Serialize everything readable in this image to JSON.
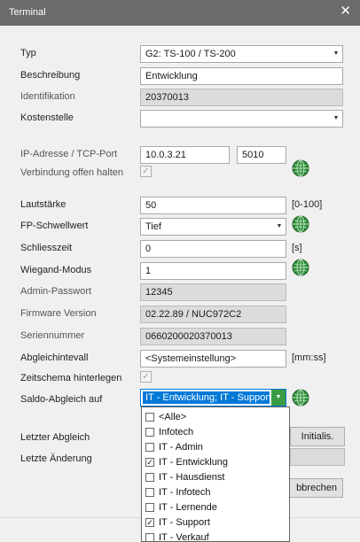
{
  "window": {
    "title": "Terminal",
    "close_glyph": "✕"
  },
  "labels": {
    "typ": "Typ",
    "beschreibung": "Beschreibung",
    "identifikation": "Identifikation",
    "kostenstelle": "Kostenstelle",
    "ip_port": "IP-Adresse / TCP-Port",
    "verbindung": "Verbindung offen halten",
    "lautstaerke": "Lautstärke",
    "fp_schwellwert": "FP-Schwellwert",
    "schliesszeit": "Schliesszeit",
    "wiegand": "Wiegand-Modus",
    "admin_passwort": "Admin-Passwort",
    "firmware": "Firmware Version",
    "seriennummer": "Seriennummer",
    "abgleichintervall": "Abgleichintevall",
    "zeitschema": "Zeitschema hinterlegen",
    "saldo": "Saldo-Abgleich auf",
    "letzter_abgleich": "Letzter Abgleich",
    "letzte_aenderung": "Letzte Änderung"
  },
  "values": {
    "typ": "G2: TS-100 / TS-200",
    "beschreibung": "Entwicklung",
    "identifikation": "20370013",
    "kostenstelle": "",
    "ip": "10.0.3.21",
    "port": "5010",
    "lautstaerke": "50",
    "fp_schwellwert": "Tief",
    "schliesszeit": "0",
    "wiegand": "1",
    "admin_passwort": "12345",
    "firmware": "02.22.89 / NUC972C2",
    "seriennummer": "0660200020370013",
    "abgleichintervall": "<Systemeinstellung>",
    "saldo": "IT - Entwicklung; IT - Support",
    "letzte_aenderung": ""
  },
  "units": {
    "lautstaerke": "[0-100]",
    "schliesszeit": "[s]",
    "abgleichintervall": "[mm:ss]"
  },
  "checkboxes": {
    "verbindung": true,
    "zeitschema": true
  },
  "buttons": {
    "initialis": "Initialis.",
    "abbrechen": "bbrechen"
  },
  "dropdown_items": [
    {
      "label": "<Alle>",
      "checked": false
    },
    {
      "label": "Infotech",
      "checked": false
    },
    {
      "label": "IT - Admin",
      "checked": false
    },
    {
      "label": "IT - Entwicklung",
      "checked": true
    },
    {
      "label": "IT - Hausdienst",
      "checked": false
    },
    {
      "label": "IT - Infotech",
      "checked": false
    },
    {
      "label": "IT - Lernende",
      "checked": false
    },
    {
      "label": "IT - Support",
      "checked": true
    },
    {
      "label": "IT - Verkauf",
      "checked": false
    }
  ],
  "icons": {
    "globe": "globe-icon",
    "checkmark": "✓",
    "combo_arrow": "▼"
  },
  "colors": {
    "titlebar": "#6b6b6b",
    "selection": "#0078d7",
    "dropdown_button": "#3a9b45",
    "globe": "#2e8b3a"
  }
}
